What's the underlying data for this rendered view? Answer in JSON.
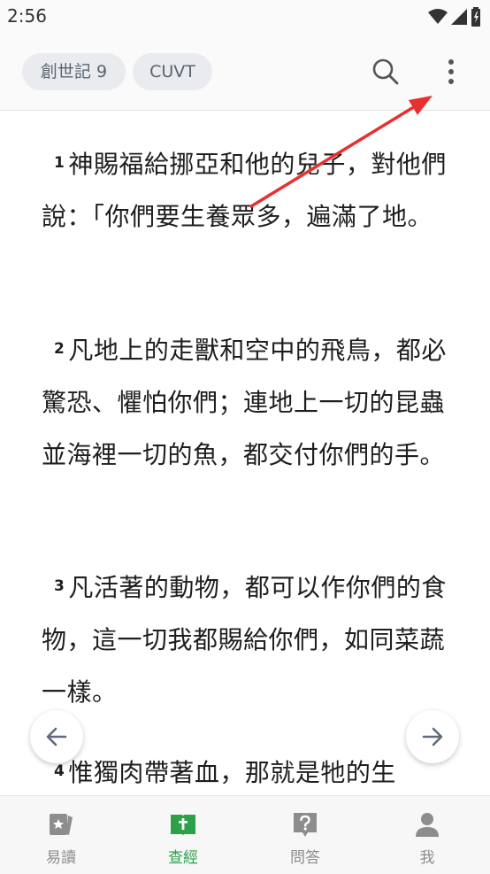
{
  "status": {
    "time": "2:56"
  },
  "header": {
    "book_chapter": "創世記 9",
    "version": "CUVT"
  },
  "verses": [
    {
      "num": "1",
      "text": "神賜福給挪亞和他的兒子，對他們說：「你們要生養眾多，遍滿了地。"
    },
    {
      "num": "2",
      "text": "凡地上的走獸和空中的飛鳥，都必驚恐、懼怕你們；連地上一切的昆蟲並海裡一切的魚，都交付你們的手。"
    },
    {
      "num": "3",
      "text": "凡活著的動物，都可以作你們的食物，這一切我都賜給你們，如同菜蔬一樣。"
    },
    {
      "num": "4",
      "text": "惟獨肉帶著血，那就是牠的生"
    }
  ],
  "bottom_nav": [
    {
      "label": "易讀",
      "icon": "star-card-icon"
    },
    {
      "label": "查經",
      "icon": "bible-icon"
    },
    {
      "label": "問答",
      "icon": "question-icon"
    },
    {
      "label": "我",
      "icon": "person-icon"
    }
  ],
  "colors": {
    "accent": "#2ca14a",
    "annotation": "#e8312f"
  }
}
